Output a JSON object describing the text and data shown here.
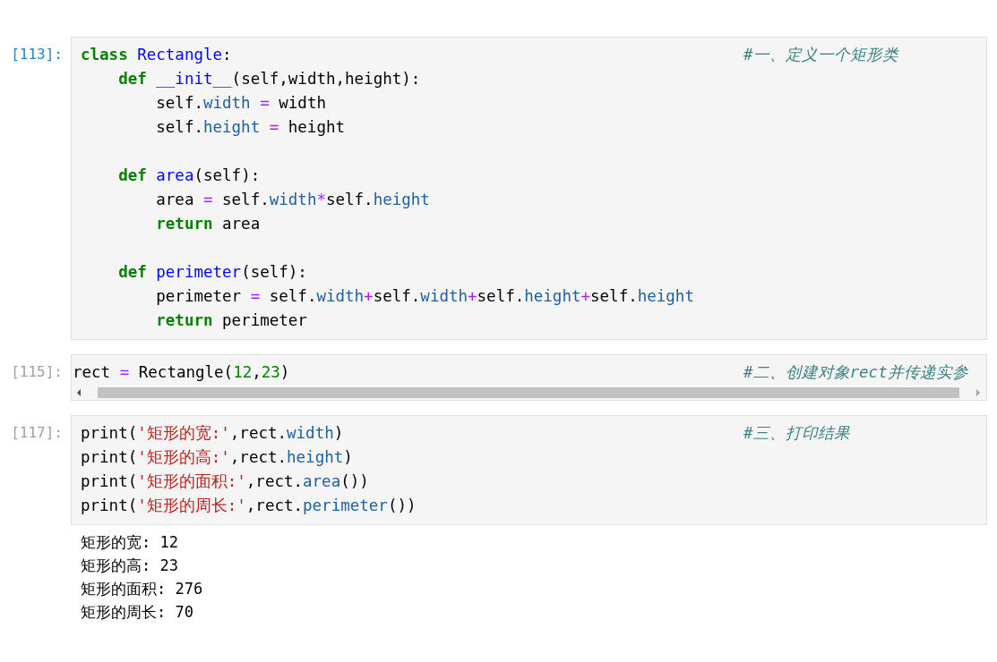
{
  "cells": [
    {
      "prompt": "[113]:",
      "selected": true,
      "scrolled": false,
      "lines": [
        {
          "kind": "code",
          "tokens": [
            {
              "kind": "kw",
              "text": "class"
            },
            {
              "kind": "def",
              "text": " Rectangle"
            },
            {
              "kind": "plain",
              "text": ":"
            }
          ],
          "comment": "#一、定义一个矩形类"
        },
        {
          "kind": "code",
          "tokens": [
            {
              "kind": "kw",
              "text": "    def"
            },
            {
              "kind": "def",
              "text": " __init__"
            },
            {
              "kind": "plain",
              "text": "(self,width,height):"
            }
          ]
        },
        {
          "kind": "code",
          "tokens": [
            {
              "kind": "plain",
              "text": "        self."
            },
            {
              "kind": "attr",
              "text": "width"
            },
            {
              "kind": "op",
              "text": " ="
            },
            {
              "kind": "plain",
              "text": " width"
            }
          ]
        },
        {
          "kind": "code",
          "tokens": [
            {
              "kind": "plain",
              "text": "        self."
            },
            {
              "kind": "attr",
              "text": "height"
            },
            {
              "kind": "op",
              "text": " ="
            },
            {
              "kind": "plain",
              "text": " height"
            }
          ]
        },
        {
          "kind": "blank"
        },
        {
          "kind": "code",
          "tokens": [
            {
              "kind": "kw",
              "text": "    def"
            },
            {
              "kind": "def",
              "text": " area"
            },
            {
              "kind": "plain",
              "text": "(self):"
            }
          ]
        },
        {
          "kind": "code",
          "tokens": [
            {
              "kind": "plain",
              "text": "        area "
            },
            {
              "kind": "op",
              "text": "="
            },
            {
              "kind": "plain",
              "text": " self."
            },
            {
              "kind": "attr",
              "text": "width"
            },
            {
              "kind": "op",
              "text": "*"
            },
            {
              "kind": "plain",
              "text": "self."
            },
            {
              "kind": "attr",
              "text": "height"
            }
          ]
        },
        {
          "kind": "code",
          "tokens": [
            {
              "kind": "kw",
              "text": "        return"
            },
            {
              "kind": "plain",
              "text": " area"
            }
          ]
        },
        {
          "kind": "blank"
        },
        {
          "kind": "code",
          "tokens": [
            {
              "kind": "kw",
              "text": "    def"
            },
            {
              "kind": "def",
              "text": " perimeter"
            },
            {
              "kind": "plain",
              "text": "(self):"
            }
          ]
        },
        {
          "kind": "code",
          "tokens": [
            {
              "kind": "plain",
              "text": "        perimeter "
            },
            {
              "kind": "op",
              "text": "="
            },
            {
              "kind": "plain",
              "text": " self."
            },
            {
              "kind": "attr",
              "text": "width"
            },
            {
              "kind": "op",
              "text": "+"
            },
            {
              "kind": "plain",
              "text": "self."
            },
            {
              "kind": "attr",
              "text": "width"
            },
            {
              "kind": "op",
              "text": "+"
            },
            {
              "kind": "plain",
              "text": "self."
            },
            {
              "kind": "attr",
              "text": "height"
            },
            {
              "kind": "op",
              "text": "+"
            },
            {
              "kind": "plain",
              "text": "self."
            },
            {
              "kind": "attr",
              "text": "height"
            }
          ]
        },
        {
          "kind": "code",
          "tokens": [
            {
              "kind": "kw",
              "text": "        return"
            },
            {
              "kind": "plain",
              "text": " perimeter"
            }
          ]
        }
      ]
    },
    {
      "prompt": "[115]:",
      "selected": false,
      "scrolled": true,
      "lines": [
        {
          "kind": "code",
          "tokens": [
            {
              "kind": "plain",
              "text": "rect "
            },
            {
              "kind": "op",
              "text": "="
            },
            {
              "kind": "plain",
              "text": " Rectangle("
            },
            {
              "kind": "num",
              "text": "12"
            },
            {
              "kind": "plain",
              "text": ","
            },
            {
              "kind": "num",
              "text": "23"
            },
            {
              "kind": "plain",
              "text": ")"
            }
          ],
          "comment": "#二、创建对象rect并传递实参"
        }
      ]
    },
    {
      "prompt": "[117]:",
      "selected": false,
      "scrolled": false,
      "lines": [
        {
          "kind": "code",
          "tokens": [
            {
              "kind": "plain",
              "text": "print("
            },
            {
              "kind": "str",
              "text": "'矩形的宽:'"
            },
            {
              "kind": "plain",
              "text": ",rect."
            },
            {
              "kind": "attr",
              "text": "width"
            },
            {
              "kind": "plain",
              "text": ")"
            }
          ],
          "comment": "#三、打印结果"
        },
        {
          "kind": "code",
          "tokens": [
            {
              "kind": "plain",
              "text": "print("
            },
            {
              "kind": "str",
              "text": "'矩形的高:'"
            },
            {
              "kind": "plain",
              "text": ",rect."
            },
            {
              "kind": "attr",
              "text": "height"
            },
            {
              "kind": "plain",
              "text": ")"
            }
          ]
        },
        {
          "kind": "code",
          "tokens": [
            {
              "kind": "plain",
              "text": "print("
            },
            {
              "kind": "str",
              "text": "'矩形的面积:'"
            },
            {
              "kind": "plain",
              "text": ",rect."
            },
            {
              "kind": "attr",
              "text": "area"
            },
            {
              "kind": "plain",
              "text": "())"
            }
          ]
        },
        {
          "kind": "code",
          "tokens": [
            {
              "kind": "plain",
              "text": "print("
            },
            {
              "kind": "str",
              "text": "'矩形的周长:'"
            },
            {
              "kind": "plain",
              "text": ",rect."
            },
            {
              "kind": "attr",
              "text": "perimeter"
            },
            {
              "kind": "plain",
              "text": "())"
            }
          ]
        }
      ],
      "output": [
        "矩形的宽: 12",
        "矩形的高: 23",
        "矩形的面积: 276",
        "矩形的周长: 70"
      ]
    }
  ]
}
